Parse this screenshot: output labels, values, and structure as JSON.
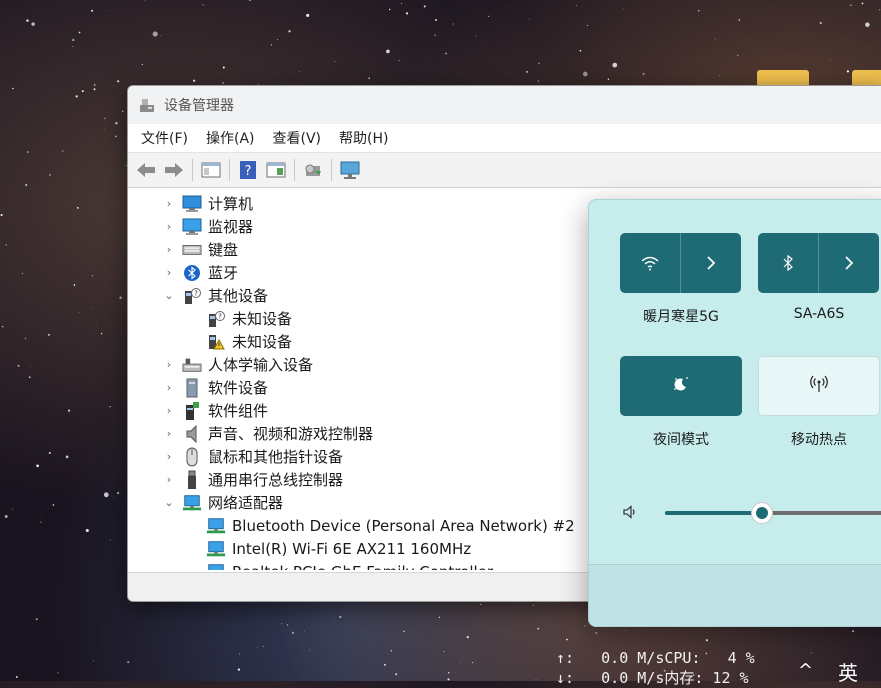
{
  "window": {
    "title": "设备管理器",
    "menu": [
      "文件(F)",
      "操作(A)",
      "查看(V)",
      "帮助(H)"
    ]
  },
  "tree": [
    {
      "label": "计算机",
      "expanded": false,
      "icon": "computer-icon",
      "child": false
    },
    {
      "label": "监视器",
      "expanded": false,
      "icon": "monitor-icon",
      "child": false
    },
    {
      "label": "键盘",
      "expanded": false,
      "icon": "keyboard-icon",
      "child": false
    },
    {
      "label": "蓝牙",
      "expanded": false,
      "icon": "bluetooth-icon",
      "child": false
    },
    {
      "label": "其他设备",
      "expanded": true,
      "icon": "unknown-device-icon",
      "child": false
    },
    {
      "label": "未知设备",
      "icon": "unknown-device-icon",
      "child": true
    },
    {
      "label": "未知设备",
      "icon": "warning-device-icon",
      "child": true
    },
    {
      "label": "人体学输入设备",
      "expanded": false,
      "icon": "hid-icon",
      "child": false
    },
    {
      "label": "软件设备",
      "expanded": false,
      "icon": "software-device-icon",
      "child": false
    },
    {
      "label": "软件组件",
      "expanded": false,
      "icon": "software-component-icon",
      "child": false
    },
    {
      "label": "声音、视频和游戏控制器",
      "expanded": false,
      "icon": "speaker-icon",
      "child": false
    },
    {
      "label": "鼠标和其他指针设备",
      "expanded": false,
      "icon": "mouse-icon",
      "child": false
    },
    {
      "label": "通用串行总线控制器",
      "expanded": false,
      "icon": "usb-icon",
      "child": false
    },
    {
      "label": "网络适配器",
      "expanded": true,
      "icon": "network-icon",
      "child": false
    },
    {
      "label": "Bluetooth Device (Personal Area Network) #2",
      "icon": "network-icon",
      "child": true
    },
    {
      "label": "Intel(R) Wi-Fi 6E AX211 160MHz",
      "icon": "network-icon",
      "child": true
    },
    {
      "label": "Realtek PCIe GbE Family Controller",
      "icon": "network-icon",
      "child": true
    }
  ],
  "quick_settings": {
    "wifi_label": "暖月寒星5G",
    "bluetooth_label": "SA-A6S",
    "night_label": "夜间模式",
    "hotspot_label": "移动热点",
    "volume_fraction": 0.42,
    "colors": {
      "accent": "#1f6b75",
      "panel": "#c6ecec"
    }
  },
  "taskbar": {
    "net_up": "↑:   0.0 M/s",
    "net_down": "↓:   0.0 M/s",
    "cpu": "CPU:   4 %",
    "mem": "内存: 12 %",
    "ime": "英"
  }
}
